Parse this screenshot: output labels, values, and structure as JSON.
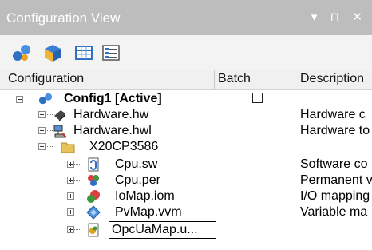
{
  "panel": {
    "title": "Configuration View",
    "controls": "▾ ⊓ ✕"
  },
  "toolbar": {
    "buttons": [
      "network-icon",
      "cube-icon",
      "grid-table-icon",
      "list-view-icon"
    ]
  },
  "columns": {
    "configuration": "Configuration",
    "batch": "Batch",
    "description": "Description"
  },
  "tree": {
    "root": {
      "label": "Config1 [Active]",
      "batch_checked": false
    },
    "hw": {
      "label": "Hardware.hw",
      "description": "Hardware c"
    },
    "hwl": {
      "label": "Hardware.hwl",
      "description": "Hardware to"
    },
    "cpu_folder": {
      "label": "X20CP3586"
    },
    "cpu_sw": {
      "label": "Cpu.sw",
      "description": "Software co"
    },
    "cpu_per": {
      "label": "Cpu.per",
      "description": "Permanent v"
    },
    "iomap": {
      "label": "IoMap.iom",
      "description": "I/O mapping"
    },
    "pvmap": {
      "label": "PvMap.vvm",
      "description": "Variable ma"
    },
    "opcua": {
      "label": "OpcUaMap.u...",
      "editing": true
    }
  },
  "colors": {
    "titlebar": "#bdbdbd",
    "toolbar": "#f3f3f3",
    "header": "#f0f0f0"
  }
}
